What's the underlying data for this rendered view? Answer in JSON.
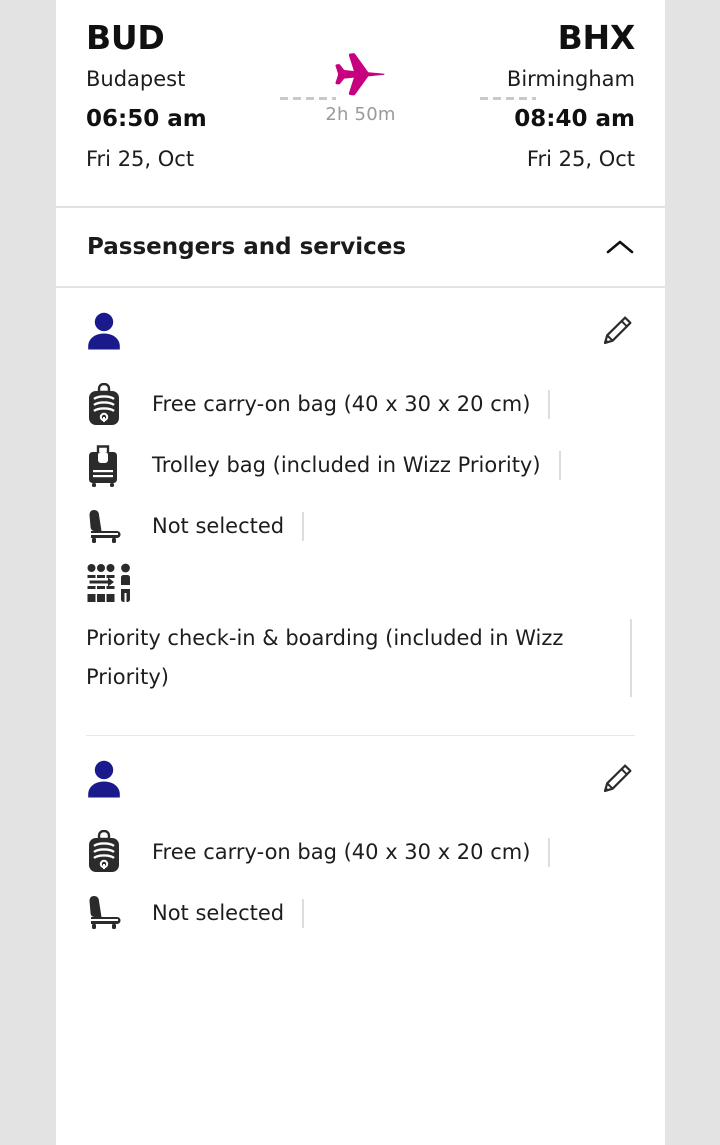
{
  "flight": {
    "origin": {
      "iata": "BUD",
      "city": "Budapest",
      "time": "06:50 am",
      "date": "Fri 25, Oct"
    },
    "destination": {
      "iata": "BHX",
      "city": "Birmingham",
      "time": "08:40 am",
      "date": "Fri 25, Oct"
    },
    "duration": "2h 50m",
    "plane_icon": "airplane-icon",
    "accent_color": "#C6007E"
  },
  "section": {
    "title": "Passengers and services",
    "toggle_icon": "chevron-up-icon",
    "expanded": true
  },
  "passengers": [
    {
      "avatar_icon": "person-icon",
      "name": "",
      "edit_icon": "pencil-icon",
      "services": [
        {
          "icon": "backpack-icon",
          "label": "Free carry-on bag (40 x 30 x 20 cm)"
        },
        {
          "icon": "trolley-bag-icon",
          "label": "Trolley bag (included in Wizz Priority)"
        },
        {
          "icon": "seat-icon",
          "label": "Not selected"
        },
        {
          "icon": "priority-boarding-icon",
          "label": "Priority check-in & boarding (included in Wizz Priority)"
        }
      ]
    },
    {
      "avatar_icon": "person-icon",
      "name": "",
      "edit_icon": "pencil-icon",
      "services": [
        {
          "icon": "backpack-icon",
          "label": "Free carry-on bag (40 x 30 x 20 cm)"
        },
        {
          "icon": "seat-icon",
          "label": "Not selected"
        }
      ]
    }
  ]
}
